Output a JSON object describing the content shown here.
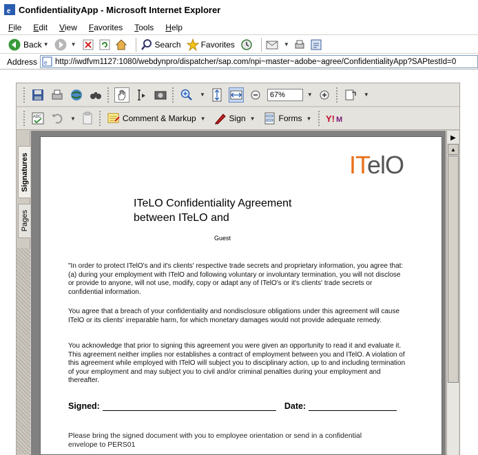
{
  "window": {
    "title": "ConfidentialityApp - Microsoft Internet Explorer"
  },
  "menu": {
    "items": [
      "File",
      "Edit",
      "View",
      "Favorites",
      "Tools",
      "Help"
    ]
  },
  "ie_toolbar": {
    "back_label": "Back",
    "search_label": "Search",
    "favorites_label": "Favorites"
  },
  "address": {
    "label": "Address",
    "url": "http://iwdfvm1127:1080/webdynpro/dispatcher/sap.com/npi~master~adobe~agree/ConfidentialityApp?SAPtestId=0"
  },
  "acrobat": {
    "zoom": "67%",
    "comment_label": "Comment & Markup",
    "sign_label": "Sign",
    "forms_label": "Forms",
    "tabs": {
      "signatures": "Signatures",
      "pages": "Pages"
    }
  },
  "document": {
    "logo_it": "IT",
    "logo_rest": "elO",
    "title_line1": "ITeLO Confidentiality Agreement",
    "title_line2": "between ITeLO and",
    "guest": "Guest",
    "para1": "\"In order to protect ITelO's and it's clients' respective trade secrets and proprietary information, you agree that: (a) during your employment with ITelO and following voluntary or involuntary termination, you will not disclose or provide to anyone, will not use, modify, copy or adapt any of ITelO's or it's clients' trade secrets or confidential information.",
    "para2": "You agree that a breach of your confidentiality and nondisclosure obligations under this agreement will cause ITelO or its clients' irreparable harm, for which monetary damages would not provide adequate remedy.",
    "para3": "You acknowledge that prior to signing this agreement you were given an opportunity to read it and evaluate it. This agreement neither implies nor establishes a contract of employment between you and ITelO. A violation of this agreement while employed with ITelO will subject you to disciplinary action, up to and including termination of your employment and may subject you to civil and/or criminal penalties during your employment and thereafter.",
    "signed_label": "Signed:",
    "date_label": "Date:",
    "note": "Please bring the signed document with you to employee orientation or send in a confidential envelope to PERS01"
  },
  "colors": {
    "logo_orange": "#e8701a",
    "logo_gray": "#555555",
    "toolbar_bg": "#e5e3de"
  }
}
